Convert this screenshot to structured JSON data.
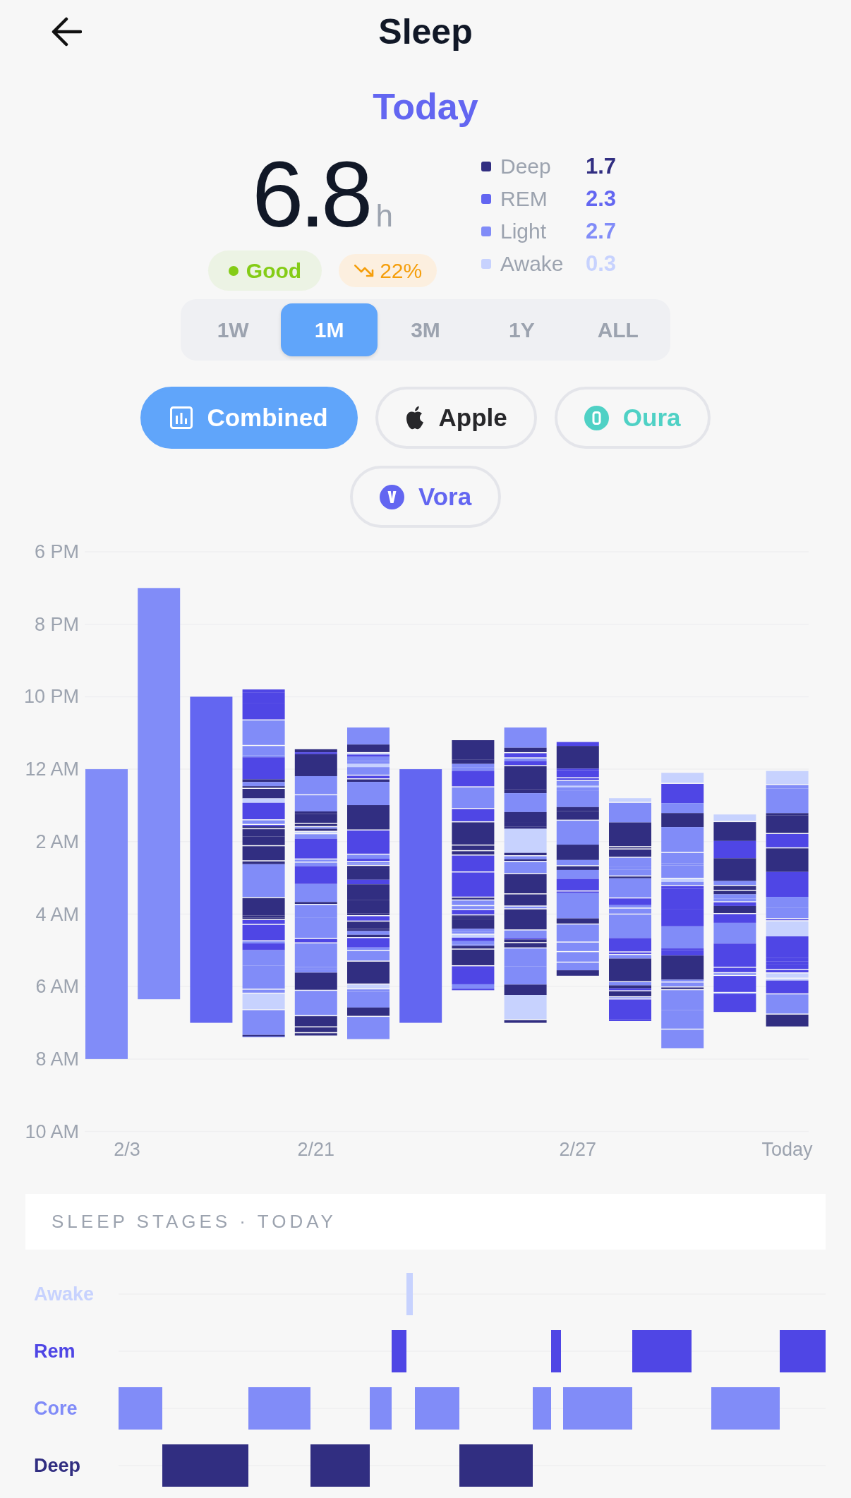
{
  "header": {
    "title": "Sleep"
  },
  "period_title": "Today",
  "summary": {
    "value": "6.8",
    "unit": "h",
    "stages": [
      {
        "label": "Deep",
        "value": "1.7",
        "color": "#312e81"
      },
      {
        "label": "REM",
        "value": "2.3",
        "color": "#6366f1"
      },
      {
        "label": "Light",
        "value": "2.7",
        "color": "#818cf8"
      },
      {
        "label": "Awake",
        "value": "0.3",
        "color": "#c7d2fe"
      }
    ]
  },
  "badges": [
    {
      "kind": "status",
      "label": "Good"
    },
    {
      "kind": "trend",
      "label": "22%"
    }
  ],
  "ranges": [
    {
      "label": "1W",
      "selected": false
    },
    {
      "label": "1M",
      "selected": true
    },
    {
      "label": "3M",
      "selected": false
    },
    {
      "label": "1Y",
      "selected": false
    },
    {
      "label": "ALL",
      "selected": false
    }
  ],
  "sources": [
    {
      "label": "Combined",
      "selected": true,
      "color": "#60a5fa"
    },
    {
      "label": "Apple",
      "selected": false,
      "color": "#27272a"
    },
    {
      "label": "Oura",
      "selected": false,
      "color": "#4fd1c5"
    },
    {
      "label": "Vora",
      "selected": false,
      "color": "#6366f1"
    }
  ],
  "sleep_chart": {
    "y_labels": [
      "6 PM",
      "8 PM",
      "10 PM",
      "12 AM",
      "2 AM",
      "4 AM",
      "6 AM",
      "8 AM",
      "10 AM"
    ],
    "x_labels": [
      "2/3",
      "2/21",
      "2/27",
      "Today"
    ],
    "bars": [
      {
        "kind": "solid",
        "color": "#818cf8"
      },
      {
        "kind": "solid",
        "color": "#818cf8"
      },
      {
        "kind": "solid",
        "color": "#6366f1"
      },
      {
        "kind": "stages"
      },
      {
        "kind": "stages"
      },
      {
        "kind": "stages"
      },
      {
        "kind": "solid",
        "color": "#6366f1"
      },
      {
        "kind": "stages"
      },
      {
        "kind": "stages"
      },
      {
        "kind": "stages"
      },
      {
        "kind": "stages"
      },
      {
        "kind": "stages"
      },
      {
        "kind": "stages"
      },
      {
        "kind": "stages"
      }
    ]
  },
  "stages_card": {
    "title": "SLEEP STAGES · TODAY"
  },
  "hypnogram": {
    "rows": [
      {
        "label": "Awake",
        "color": "#c7d2fe"
      },
      {
        "label": "Rem",
        "color": "#4f46e5"
      },
      {
        "label": "Core",
        "color": "#818cf8"
      },
      {
        "label": "Deep",
        "color": "#312e81"
      }
    ]
  }
}
